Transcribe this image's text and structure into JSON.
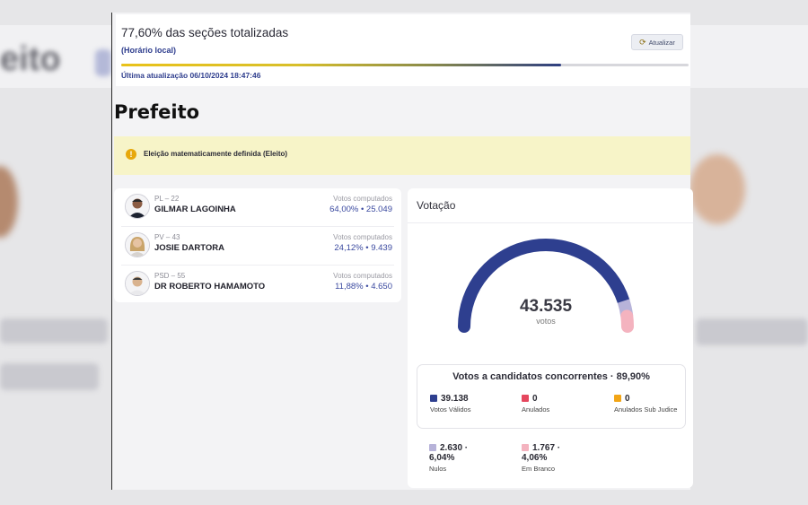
{
  "header": {
    "percent_title": "77,60% das seções totalizadas",
    "local_time": "(Horário local)",
    "refresh_label": "Atualizar",
    "progress": 0.776,
    "last_update": "Última atualização 06/10/2024 18:47:46"
  },
  "office": "Prefeito",
  "alert": {
    "text": "Eleição matematicamente definida (Eleito)",
    "color": "#e7a80b"
  },
  "candidates": [
    {
      "party": "PL – 22",
      "name": "GILMAR LAGOINHA",
      "votes_label": "Votos computados",
      "votes": "64,00% • 25.049"
    },
    {
      "party": "PV – 43",
      "name": "JOSIE DARTORA",
      "votes_label": "Votos computados",
      "votes": "24,12% • 9.439"
    },
    {
      "party": "PSD – 55",
      "name": "DR ROBERTO HAMAMOTO",
      "votes_label": "Votos computados",
      "votes": "11,88% • 4.650"
    }
  ],
  "votacao": {
    "title": "Votação",
    "total": "43.535",
    "total_unit": "votos",
    "concorrentes_title": "Votos a candidatos concorrentes · 89,90%",
    "gauge": {
      "valid_fraction": 0.899,
      "nulos_fraction": 0.0604,
      "branco_fraction": 0.0406
    },
    "stats": [
      {
        "value": "39.138",
        "label": "Votos Válidos",
        "color": "#2e3f8f"
      },
      {
        "value": "0",
        "label": "Anulados",
        "color": "#e5475e"
      },
      {
        "value": "0",
        "label": "Anulados Sub Judice",
        "color": "#f2a516"
      },
      {
        "value": "2.630 ·",
        "value2": "6,04%",
        "label": "Nulos",
        "color": "#b7b3d9"
      },
      {
        "value": "1.767 ·",
        "value2": "4,06%",
        "label": "Em Branco",
        "color": "#f4b3bf"
      }
    ]
  },
  "colors": {
    "valid": "#2e3f8f",
    "nulos": "#b7b3d9",
    "branco": "#f4b3bf",
    "accent": "#2f3e8e"
  }
}
